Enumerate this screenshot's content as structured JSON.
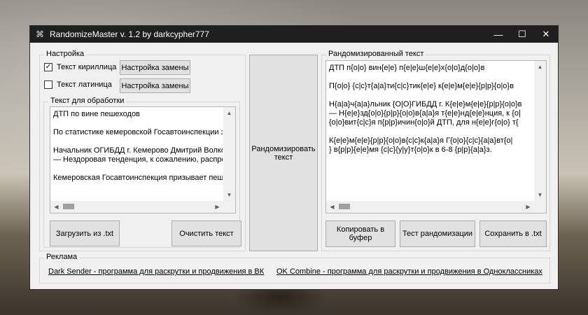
{
  "window": {
    "title": "RandomizeMaster v. 1.2 by darkcypher777",
    "minimize_glyph": "—",
    "maximize_glyph": "☐",
    "close_glyph": "✕",
    "icon_glyph": "⌘"
  },
  "settings": {
    "group_title": "Настройка",
    "cyrillic_label": "Текст кириллица",
    "cyrillic_checked": true,
    "check_mark": "✓",
    "cyrillic_settings_button": "Настройка замены",
    "latin_label": "Текст латиница",
    "latin_checked": false,
    "latin_settings_button": "Настройка замены"
  },
  "source": {
    "group_title": "Текст для обработки",
    "text": "ДТП по вине пешеходов\n\nПо статистике кемеровской Госавтоинспекции за\n\nНачальник ОГИБДД г. Кемерово Дмитрий Волков\n— Нездоровая тенденция, к сожалению, распро\n\nКемеровская Госавтоинспекция призывает пеше",
    "load_button": "Загрузить из .txt",
    "clear_button": "Очистить текст"
  },
  "randomize_button": "Рандомизировать\nтекст",
  "result": {
    "group_title": "Рандомизированный текст",
    "text": "ДТП п{о|о} вин{е|е} п{е|е}ш{е|е}х{о|о}д{о|о}в\n\nП{о|о} {с|с}т{а|а}ти{с|с}тик{е|е} к{е|е}м{е|е}{р|р}{о|о}в\n\nН{а|а}ч{а|а}льник {О|О}ГИБДД г. К{е|е}м{е|е}{р|р}{о|о}в\n— Н{е|е}зд{о|о}{р|р}{о|о}в{а|а}я т{е|е}нд{е|е}нция, к {о|\n{о|о}вит{с|с}я п{р|р}ичин{о|о}й ДТП, для н{е|е}г{о|о} т{\n\nК{е|е}м{е|е}{р|р}{о|о}в{с|с}к{а|а}я Г{о|о}{с|с}{а|а}вт{о|\n} в{р|р}{е|е}мя {с|с}{у|у}т{о|о}к в 6-8 {р|р}{а|а}з.",
    "copy_button": "Копировать в\nбуфер",
    "test_button": "Тест рандомизации",
    "save_button": "Сохранить в .txt"
  },
  "ads": {
    "group_title": "Реклама",
    "link1": "Dark Sender - программа для раскрутки и продвижения в ВК",
    "link2": "OK Combine - программа для раскрутки и продвижения в Одноклассниках"
  },
  "scroll": {
    "up": "▲",
    "down": "▼",
    "left": "◀",
    "right": "▶"
  }
}
